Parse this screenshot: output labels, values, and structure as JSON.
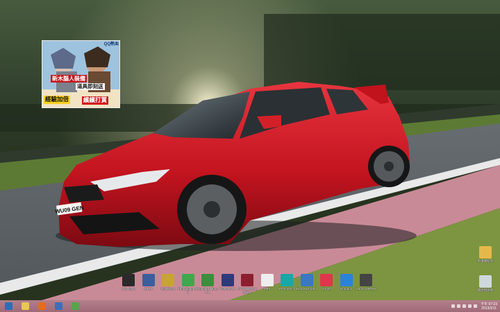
{
  "wallpaper": {
    "plate_text": "WU09 GEN"
  },
  "advert": {
    "header": "QQ熱血",
    "line1": "新木腦人裝備",
    "line2": "道具即刻送",
    "line3": "經驗加倍",
    "line4": "繽繽打賞"
  },
  "desktop_icons": [
    {
      "label": "CD player",
      "color": "#2a2a2a",
      "icon": "cd-player-icon"
    },
    {
      "label": "SPSS",
      "color": "#3b5f9e",
      "icon": "spss-icon"
    },
    {
      "label": "GoldWave",
      "color": "#c8a434",
      "icon": "goldwave-icon"
    },
    {
      "label": "PhotoScape 3.6",
      "color": "#3fa84d",
      "icon": "photoscape-icon"
    },
    {
      "label": "Xpadder Mouse 1",
      "color": "#3c8e3c",
      "icon": "xpadder-icon"
    },
    {
      "label": "PowerDVD",
      "color": "#2f3a7a",
      "icon": "powerdvd-icon"
    },
    {
      "label": "AV WWINGAL Online",
      "color": "#8c1f2f",
      "icon": "game-shield-icon"
    },
    {
      "label": "MP3",
      "color": "#eeeeee",
      "icon": "document-icon"
    },
    {
      "label": "PrimoPoint",
      "color": "#1aa6a6",
      "icon": "wifi-icon"
    },
    {
      "label": "DropX Dropbox",
      "color": "#3b78c4",
      "icon": "dropx-icon"
    },
    {
      "label": "iTunes",
      "color": "#e0354b",
      "icon": "itunes-icon"
    },
    {
      "label": "Dropbox",
      "color": "#2b82d9",
      "icon": "dropbox-icon"
    },
    {
      "label": "Canon MP250",
      "color": "#444444",
      "icon": "printer-icon"
    }
  ],
  "right_icons": [
    {
      "label": "新增資料夾",
      "color": "#e4b94a",
      "icon": "folder-icon"
    },
    {
      "label": "資源回收筒",
      "color": "#cfd8dc",
      "icon": "recycle-bin-icon"
    }
  ],
  "taskbar": {
    "pinned": [
      {
        "name": "start-button",
        "color": "#2a6fb6",
        "icon": "windows-logo-icon"
      },
      {
        "name": "explorer-button",
        "color": "#e8c65a",
        "icon": "folder-icon"
      },
      {
        "name": "firefox-button",
        "color": "#e66b1f",
        "icon": "firefox-icon"
      },
      {
        "name": "browser-button",
        "color": "#3e6fb8",
        "icon": "globe-icon"
      },
      {
        "name": "app-button",
        "color": "#5aa34a",
        "icon": "app-icon"
      }
    ],
    "clock_time": "下午 07:23",
    "clock_date": "2013/3/11"
  }
}
